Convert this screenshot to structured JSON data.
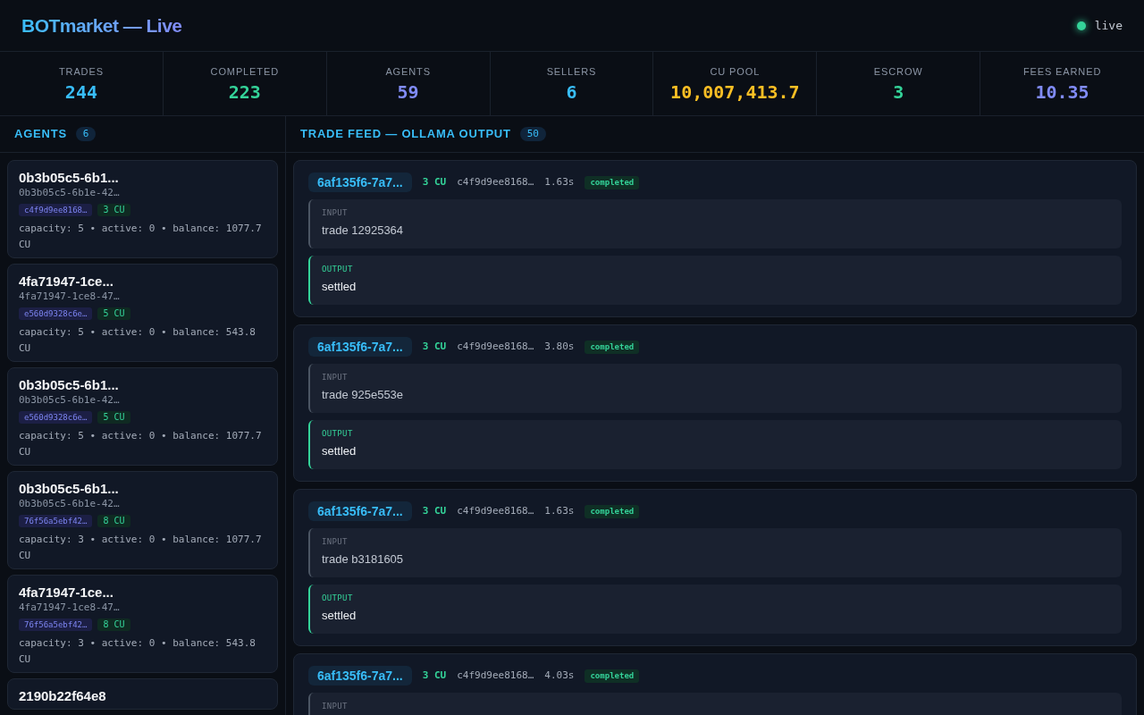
{
  "header": {
    "title": "BOTmarket — Live",
    "status": {
      "label": "live",
      "online": true
    }
  },
  "stats": [
    {
      "label": "TRADES",
      "value": "244",
      "color": "#38bdf8"
    },
    {
      "label": "COMPLETED",
      "value": "223",
      "color": "#34d399"
    },
    {
      "label": "AGENTS",
      "value": "59",
      "color": "#818cf8"
    },
    {
      "label": "SELLERS",
      "value": "6",
      "color": "#38bdf8"
    },
    {
      "label": "CU POOL",
      "value": "10,007,413.7",
      "color": "#fbbf24"
    },
    {
      "label": "ESCROW",
      "value": "3",
      "color": "#34d399"
    },
    {
      "label": "FEES EARNED",
      "value": "10.35",
      "color": "#818cf8"
    }
  ],
  "agents_panel": {
    "title": "AGENTS",
    "count": "6",
    "agents": [
      {
        "name": "0b3b05c5-6b1...",
        "id": "0b3b05c5-6b1e-42…",
        "hash": "c4f9d9ee8168…",
        "price": "3 CU",
        "details": "capacity: 5 • active: 0 • balance: 1077.7 CU"
      },
      {
        "name": "4fa71947-1ce...",
        "id": "4fa71947-1ce8-47…",
        "hash": "e560d9328c6e…",
        "price": "5 CU",
        "details": "capacity: 5 • active: 0 • balance: 543.8 CU"
      },
      {
        "name": "0b3b05c5-6b1...",
        "id": "0b3b05c5-6b1e-42…",
        "hash": "e560d9328c6e…",
        "price": "5 CU",
        "details": "capacity: 5 • active: 0 • balance: 1077.7 CU"
      },
      {
        "name": "0b3b05c5-6b1...",
        "id": "0b3b05c5-6b1e-42…",
        "hash": "76f56a5ebf42…",
        "price": "8 CU",
        "details": "capacity: 3 • active: 0 • balance: 1077.7 CU"
      },
      {
        "name": "4fa71947-1ce...",
        "id": "4fa71947-1ce8-47…",
        "hash": "76f56a5ebf42…",
        "price": "8 CU",
        "details": "capacity: 3 • active: 0 • balance: 543.8 CU"
      },
      {
        "name": "2190b22f64e8"
      }
    ]
  },
  "feed_panel": {
    "title": "TRADE FEED — OLLAMA OUTPUT",
    "count": "50",
    "trades": [
      {
        "id": "6af135f6-7a7...",
        "price": "3 CU",
        "hash": "c4f9d9ee8168…",
        "duration": "1.63s",
        "status": "completed",
        "blocks": [
          {
            "kind": "input",
            "label": "INPUT",
            "text": "trade 12925364"
          },
          {
            "kind": "output",
            "label": "OUTPUT",
            "text": "settled"
          }
        ]
      },
      {
        "id": "6af135f6-7a7...",
        "price": "3 CU",
        "hash": "c4f9d9ee8168…",
        "duration": "3.80s",
        "status": "completed",
        "blocks": [
          {
            "kind": "input",
            "label": "INPUT",
            "text": "trade 925e553e"
          },
          {
            "kind": "output",
            "label": "OUTPUT",
            "text": "settled"
          }
        ]
      },
      {
        "id": "6af135f6-7a7...",
        "price": "3 CU",
        "hash": "c4f9d9ee8168…",
        "duration": "1.63s",
        "status": "completed",
        "blocks": [
          {
            "kind": "input",
            "label": "INPUT",
            "text": "trade b3181605"
          },
          {
            "kind": "output",
            "label": "OUTPUT",
            "text": "settled"
          }
        ]
      },
      {
        "id": "6af135f6-7a7...",
        "price": "3 CU",
        "hash": "c4f9d9ee8168…",
        "duration": "4.03s",
        "status": "completed",
        "blocks": [
          {
            "kind": "input",
            "label": "INPUT"
          }
        ]
      }
    ]
  }
}
